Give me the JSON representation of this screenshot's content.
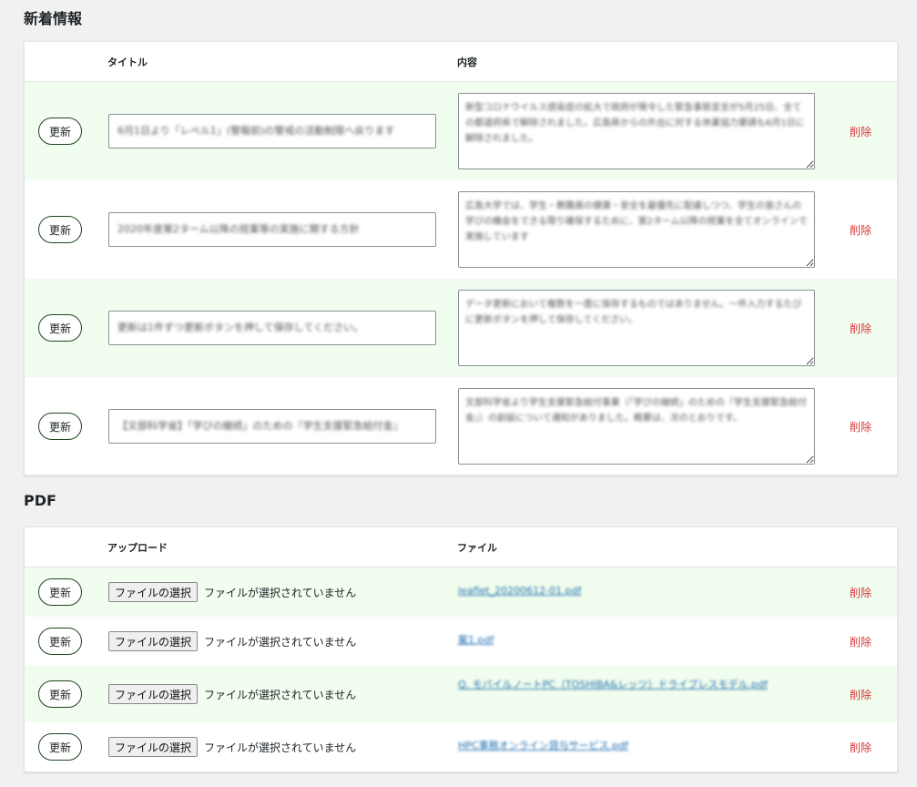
{
  "news": {
    "heading": "新着情報",
    "col_title": "タイトル",
    "col_content": "内容",
    "rows": [
      {
        "update_label": "更新",
        "title": "6月1日より「レベル1」(警報前)の警戒の活動制限へ戻ります",
        "content": "新型コロナウイルス感染症の拡大で政府が発令した緊急事態宣言が5月25日、全ての都道府県で解除されました。広島県からの外出に対する休業協力要請も6月1日に解除されました。",
        "delete_label": "削除"
      },
      {
        "update_label": "更新",
        "title": "2020年度第2ターム以降の授業等の実施に関する方針",
        "content": "広島大学では、学生・教職員の健康・安全を最優先に配慮しつつ、学生の皆さんの学びの機会をできる限り確保するために、第2ターム以降の授業を全てオンラインで実施しています",
        "delete_label": "削除"
      },
      {
        "update_label": "更新",
        "title": "更新は1件ずつ更新ボタンを押して保存してください。",
        "content": "データ更新において複数を一度に保存するものではありません。一件入力するたびに更新ボタンを押して保存してください。",
        "delete_label": "削除"
      },
      {
        "update_label": "更新",
        "title": "【文部科学省】「学びの継続」のための『学生支援緊急給付金』",
        "content": "文部科学省より学生支援緊急給付事業（「学びの継続」のための『学生支援緊急給付金』）の創設について通知がありました。概要は、次のとおりです。",
        "delete_label": "削除"
      }
    ]
  },
  "pdf": {
    "heading": "PDF",
    "col_upload": "アップロード",
    "col_file": "ファイル",
    "rows": [
      {
        "update_label": "更新",
        "choose_label": "ファイルの選択",
        "status": "ファイルが選択されていません",
        "file": "leaflet_20200612-01.pdf",
        "delete_label": "削除"
      },
      {
        "update_label": "更新",
        "choose_label": "ファイルの選択",
        "status": "ファイルが選択されていません",
        "file": "案1.pdf",
        "delete_label": "削除"
      },
      {
        "update_label": "更新",
        "choose_label": "ファイルの選択",
        "status": "ファイルが選択されていません",
        "file": "Q. モバイルノートPC（TOSHIBA&レッツ）ドライブレスモデル.pdf",
        "delete_label": "削除"
      },
      {
        "update_label": "更新",
        "choose_label": "ファイルの選択",
        "status": "ファイルが選択されていません",
        "file": "HPC事務オンライン貸与サービス.pdf",
        "delete_label": "削除"
      }
    ]
  },
  "colors": {
    "row_alt": "#f1fdee",
    "delete": "#d63638",
    "link": "#2271b1",
    "button_border": "#1e4620"
  }
}
